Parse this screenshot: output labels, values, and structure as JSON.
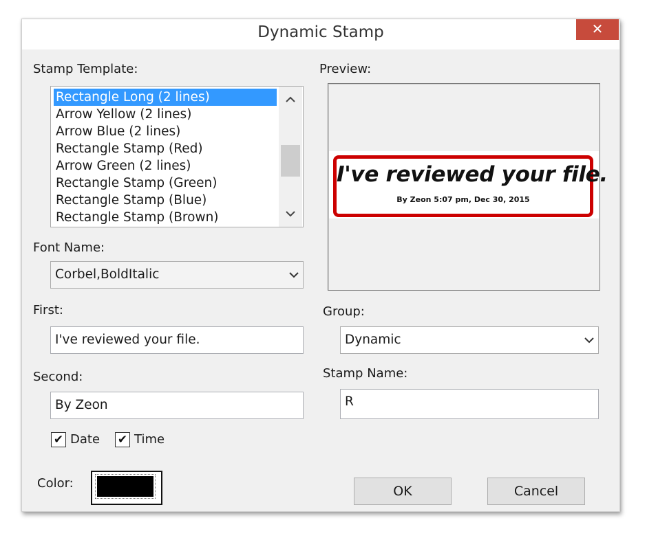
{
  "window": {
    "title": "Dynamic Stamp",
    "close_label": "✕"
  },
  "stamp_template": {
    "label": "Stamp Template:",
    "items": [
      "Rectangle Long (2 lines)",
      "Arrow Yellow (2 lines)",
      "Arrow Blue (2 lines)",
      "Rectangle Stamp (Red)",
      "Arrow Green (2 lines)",
      "Rectangle Stamp (Green)",
      "Rectangle Stamp (Blue)",
      "Rectangle Stamp (Brown)"
    ],
    "selected_index": 0,
    "scroll_up": "⌃",
    "scroll_down": "⌄"
  },
  "font_name": {
    "label": "Font Name:",
    "value": "Corbel,BoldItalic"
  },
  "first": {
    "label": "First:",
    "value": "I've reviewed your file."
  },
  "second": {
    "label": "Second:",
    "value": "By Zeon"
  },
  "date_checkbox": {
    "label": "Date",
    "checked": true,
    "mark": "✔"
  },
  "time_checkbox": {
    "label": "Time",
    "checked": true,
    "mark": "✔"
  },
  "color": {
    "label": "Color:",
    "value": "#000000"
  },
  "preview": {
    "label": "Preview:",
    "stamp_line1": "I've reviewed your file.",
    "stamp_line2": "By Zeon 5:07 pm, Dec 30, 2015",
    "border_color": "#cc0000"
  },
  "group": {
    "label": "Group:",
    "value": "Dynamic"
  },
  "stamp_name": {
    "label": "Stamp Name:",
    "value": "R"
  },
  "buttons": {
    "ok": "OK",
    "cancel": "Cancel"
  },
  "icons": {
    "dropdown": "chevron-down-icon",
    "check": "checkmark-icon",
    "close": "close-icon"
  }
}
